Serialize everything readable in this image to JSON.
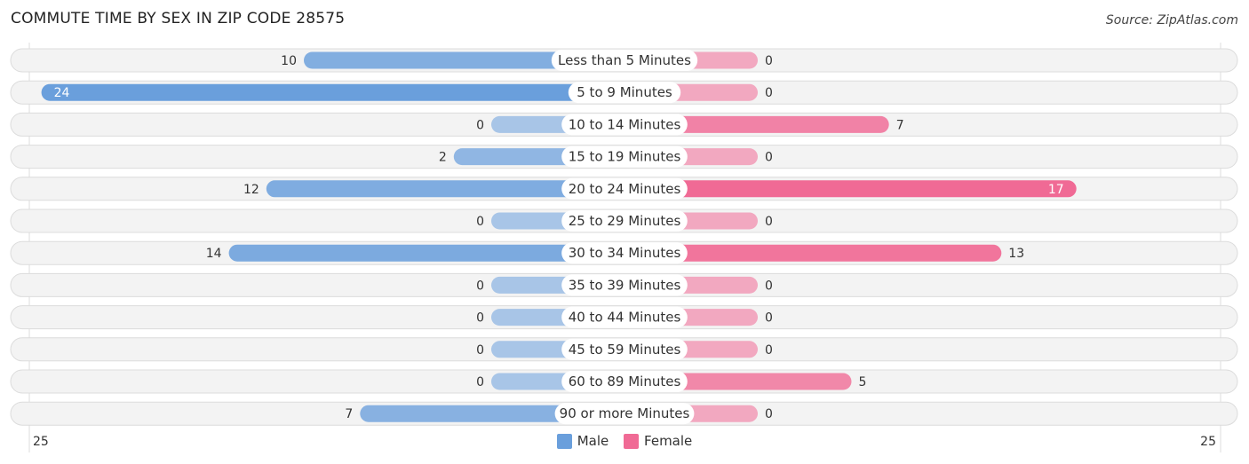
{
  "chart_data": {
    "type": "bar",
    "orientation": "horizontal-diverging",
    "title": "COMMUTE TIME BY SEX IN ZIP CODE 28575",
    "source": "Source: ZipAtlas.com",
    "categories": [
      "Less than 5 Minutes",
      "5 to 9 Minutes",
      "10 to 14 Minutes",
      "15 to 19 Minutes",
      "20 to 24 Minutes",
      "25 to 29 Minutes",
      "30 to 34 Minutes",
      "35 to 39 Minutes",
      "40 to 44 Minutes",
      "45 to 59 Minutes",
      "60 to 89 Minutes",
      "90 or more Minutes"
    ],
    "series": [
      {
        "name": "Male",
        "color": "#6a9fdc",
        "values": [
          10,
          24,
          0,
          2,
          12,
          0,
          14,
          0,
          0,
          0,
          0,
          7
        ]
      },
      {
        "name": "Female",
        "color": "#f06a95",
        "values": [
          0,
          0,
          7,
          0,
          17,
          0,
          13,
          0,
          0,
          0,
          5,
          0
        ]
      }
    ],
    "axis": {
      "left_label": "25",
      "right_label": "25",
      "max": 25
    },
    "legend": {
      "position": "bottom-center"
    }
  }
}
